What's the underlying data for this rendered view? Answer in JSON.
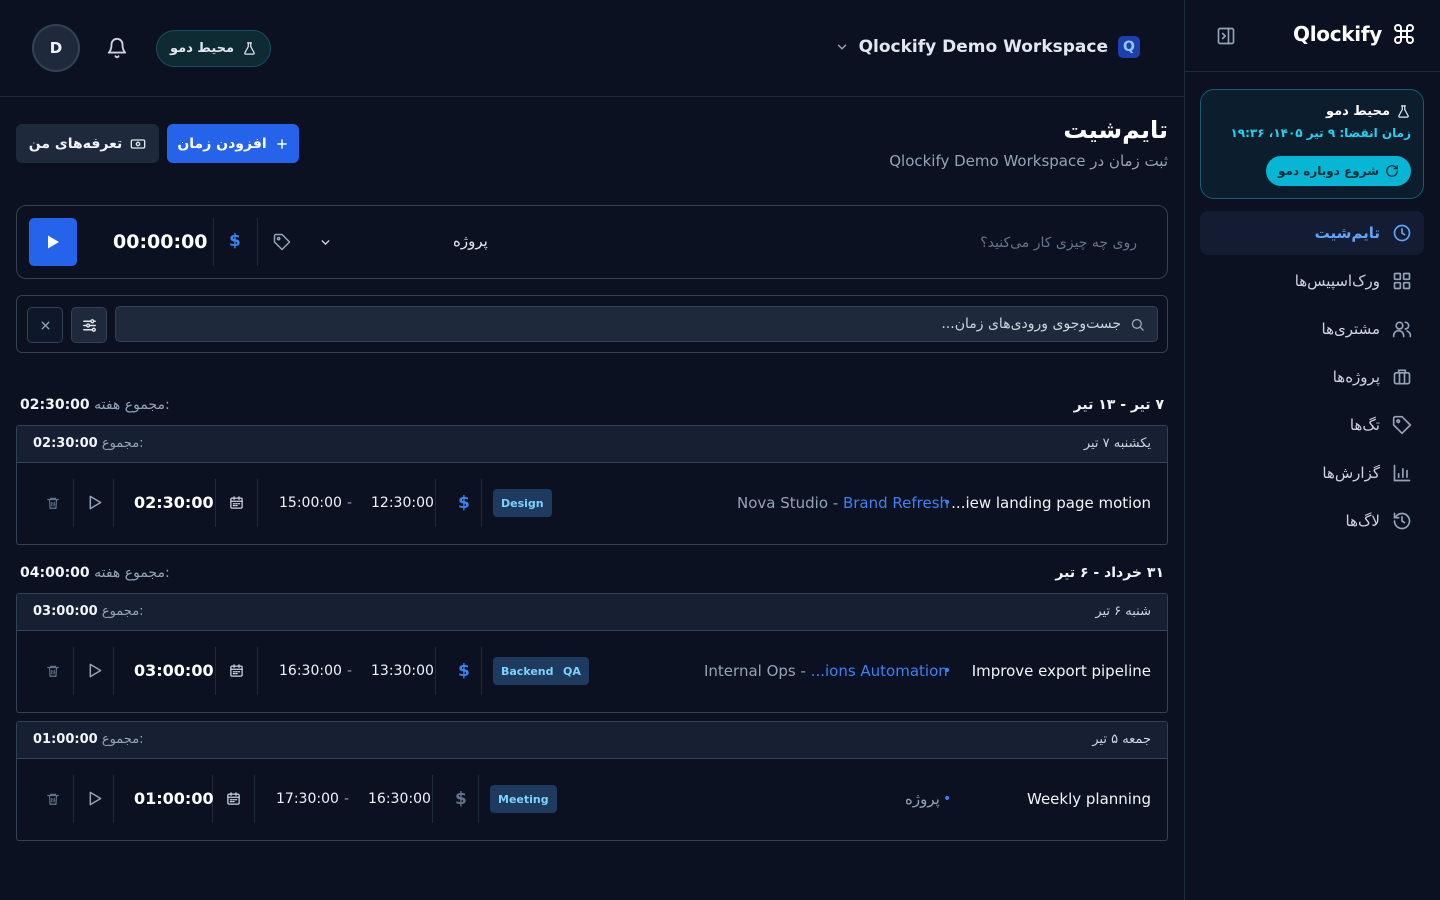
{
  "sidebar": {
    "brand": "Qlockify",
    "demo": {
      "title": "محیط دمو",
      "expire": "زمان انقضا: ۹ تیر ۱۴۰۵، ۱۹:۳۶",
      "restart": "شروع دوباره دمو"
    },
    "nav": [
      {
        "label": "تایم‌شیت",
        "icon": "clock-icon",
        "active": true
      },
      {
        "label": "ورک‌اسپیس‌ها",
        "icon": "grid-icon",
        "active": false
      },
      {
        "label": "مشتری‌ها",
        "icon": "users-icon",
        "active": false
      },
      {
        "label": "پروژه‌ها",
        "icon": "briefcase-icon",
        "active": false
      },
      {
        "label": "تگ‌ها",
        "icon": "tag-icon",
        "active": false
      },
      {
        "label": "گزارش‌ها",
        "icon": "bar-chart-icon",
        "active": false
      },
      {
        "label": "لاگ‌ها",
        "icon": "history-icon",
        "active": false
      }
    ]
  },
  "header": {
    "avatar": "D",
    "demo_pill": "محیط دمو",
    "workspace": "Qlockify Demo Workspace",
    "workspace_badge": "Q"
  },
  "page": {
    "title": "تایم‌شیت",
    "subtitle": "ثبت زمان در Qlockify Demo Workspace",
    "add_time": "افزودن زمان",
    "my_rates": "تعرفه‌های من"
  },
  "timer": {
    "placeholder": "روی چه چیزی کار می‌کنید؟",
    "project": "پروژه",
    "billable_symbol": "$",
    "time": "00:00:00"
  },
  "search": {
    "placeholder": "جست‌وجوی ورودی‌های زمان..."
  },
  "labels": {
    "week_total": "مجموع هفته:",
    "day_total": "مجموع:"
  },
  "weeks": [
    {
      "range": "۷ تیر - ۱۳ تیر",
      "total": "02:30:00",
      "days": [
        {
          "label": "یکشنبه ۷ تیر",
          "total": "02:30:00",
          "entries": [
            {
              "description": "...iew landing page motion",
              "client": "Nova Studio - ",
              "project": "Brand Refresh",
              "tags": [
                "Design"
              ],
              "billable": true,
              "start": "12:30:00",
              "end": "15:00:00",
              "duration": "02:30:00"
            }
          ]
        }
      ]
    },
    {
      "range": "۳۱ خرداد - ۶ تیر",
      "total": "04:00:00",
      "days": [
        {
          "label": "شنبه ۶ تیر",
          "total": "03:00:00",
          "entries": [
            {
              "description": "Improve export pipeline",
              "client": "Internal Ops - ",
              "project": "...ions Automation",
              "tags": [
                "QA",
                "Backend"
              ],
              "billable": true,
              "start": "13:30:00",
              "end": "16:30:00",
              "duration": "03:00:00"
            }
          ]
        },
        {
          "label": "جمعه ۵ تیر",
          "total": "01:00:00",
          "entries": [
            {
              "description": "Weekly planning",
              "client": "",
              "project": "پروژه",
              "tags": [
                "Meeting"
              ],
              "billable": false,
              "start": "16:30:00",
              "end": "17:30:00",
              "duration": "01:00:00"
            }
          ]
        }
      ]
    }
  ],
  "colors": {
    "accent": "#2563eb",
    "cyan": "#06b6d4",
    "background": "#0b1120"
  }
}
